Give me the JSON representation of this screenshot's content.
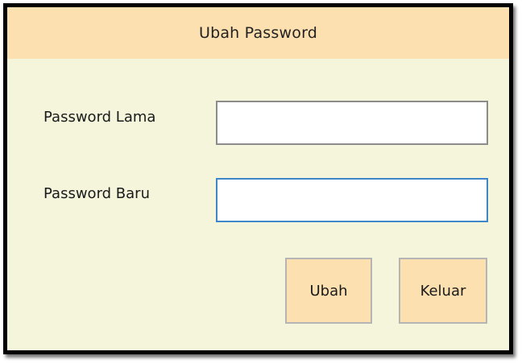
{
  "window": {
    "title": "Ubah Password"
  },
  "form": {
    "old_password": {
      "label": "Password Lama",
      "value": ""
    },
    "new_password": {
      "label": "Password Baru",
      "value": ""
    }
  },
  "buttons": {
    "submit_label": "Ubah",
    "exit_label": "Keluar"
  },
  "colors": {
    "window_background": "#f5f5dc",
    "title_bar": "#fde0b0",
    "button_background": "#fde0b0",
    "focused_field_border": "#3f86c8"
  }
}
